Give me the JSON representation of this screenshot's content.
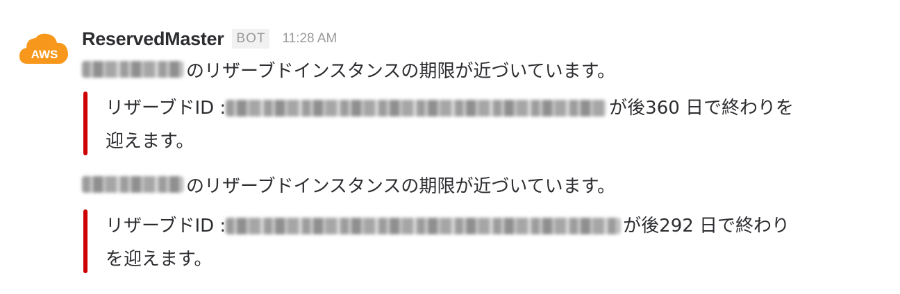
{
  "sender": {
    "name": "ReservedMaster",
    "badge": "BOT",
    "time": "11:28 AM",
    "avatar_icon": "aws-cloud-icon",
    "avatar_label": "AWS",
    "avatar_color": "#f7981d"
  },
  "messages": [
    {
      "text": "のリザーブドインスタンスの期限が近づいています。",
      "attachment": {
        "prefix": "リザーブドID :",
        "suffix_line1": "が後360 日で終わりを",
        "line2": "迎えます。",
        "bar_color": "#cc0000"
      }
    },
    {
      "text": "のリザーブドインスタンスの期限が近づいています。",
      "attachment": {
        "prefix": "リザーブドID :",
        "suffix_line1": "が後292 日で終わり",
        "line2": "を迎えます。",
        "bar_color": "#cc0000"
      }
    }
  ]
}
